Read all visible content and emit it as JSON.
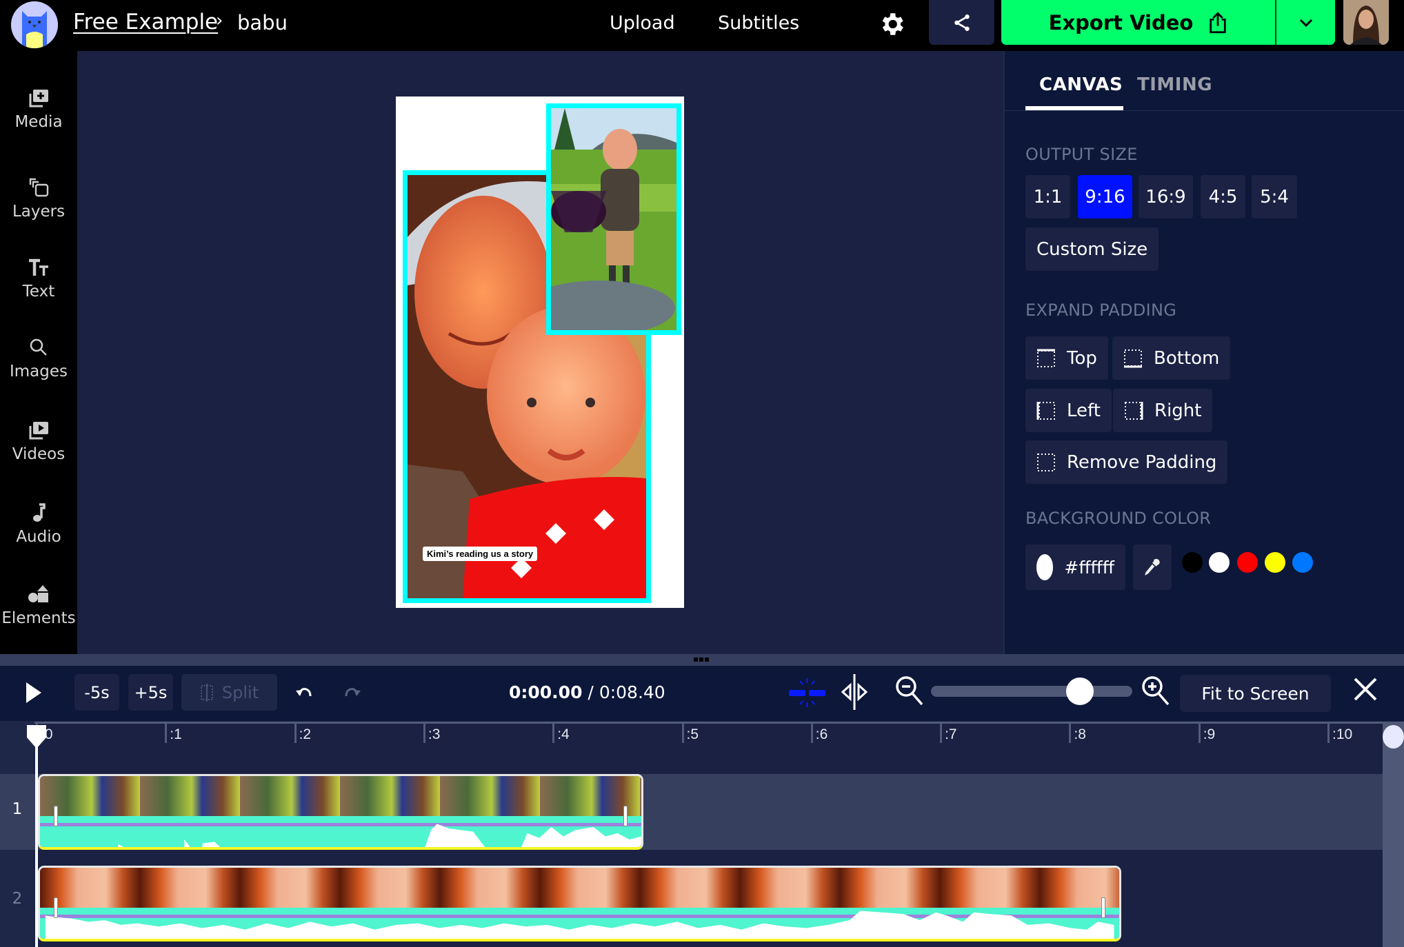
{
  "topbar": {
    "breadcrumb_root": "Free Example",
    "breadcrumb_separator": "›",
    "project_name": "babu",
    "nav": [
      "Upload",
      "Subtitles"
    ],
    "export_label": "Export Video",
    "colors": {
      "export": "#00ff6a",
      "bar": "#000000"
    }
  },
  "sidebar": {
    "items": [
      {
        "label": "Media",
        "icon": "media-plus-icon"
      },
      {
        "label": "Layers",
        "icon": "layers-icon"
      },
      {
        "label": "Text",
        "icon": "text-icon"
      },
      {
        "label": "Images",
        "icon": "search-icon"
      },
      {
        "label": "Videos",
        "icon": "video-play-icon"
      },
      {
        "label": "Audio",
        "icon": "music-note-icon"
      },
      {
        "label": "Elements",
        "icon": "shapes-icon"
      }
    ]
  },
  "canvas": {
    "background": "#ffffff",
    "caption": "Kimi’s reading us a story",
    "selection_color": "#00ffff"
  },
  "panel": {
    "tabs": [
      {
        "label": "CANVAS",
        "active": true
      },
      {
        "label": "TIMING",
        "active": false
      }
    ],
    "output_size": {
      "title": "OUTPUT SIZE",
      "options": [
        "1:1",
        "9:16",
        "16:9",
        "4:5",
        "5:4"
      ],
      "selected": "9:16",
      "custom_label": "Custom Size"
    },
    "expand_padding": {
      "title": "EXPAND PADDING",
      "buttons": [
        "Top",
        "Bottom",
        "Left",
        "Right",
        "Remove Padding"
      ]
    },
    "background_color": {
      "title": "BACKGROUND COLOR",
      "value": "#ffffff",
      "presets": [
        "#000000",
        "#ffffff",
        "#ff0000",
        "#ffff00",
        "#0077ff"
      ]
    }
  },
  "timeline": {
    "controls": {
      "back_label": "-5s",
      "forward_label": "+5s",
      "split_label": "Split",
      "current_time": "0:00.00",
      "separator": " / ",
      "duration": "0:08.40",
      "fit_label": "Fit to Screen",
      "zoom_level": 0.74
    },
    "ruler_labels": [
      ":0",
      ":1",
      ":2",
      ":3",
      ":4",
      ":5",
      ":6",
      ":7",
      ":8",
      ":9",
      ":10"
    ],
    "tracks": [
      {
        "number": "1",
        "start_s": 0,
        "end_s": 4.7,
        "selected": true
      },
      {
        "number": "2",
        "start_s": 0,
        "end_s": 8.4,
        "selected": false
      }
    ],
    "playhead_s": 0
  }
}
